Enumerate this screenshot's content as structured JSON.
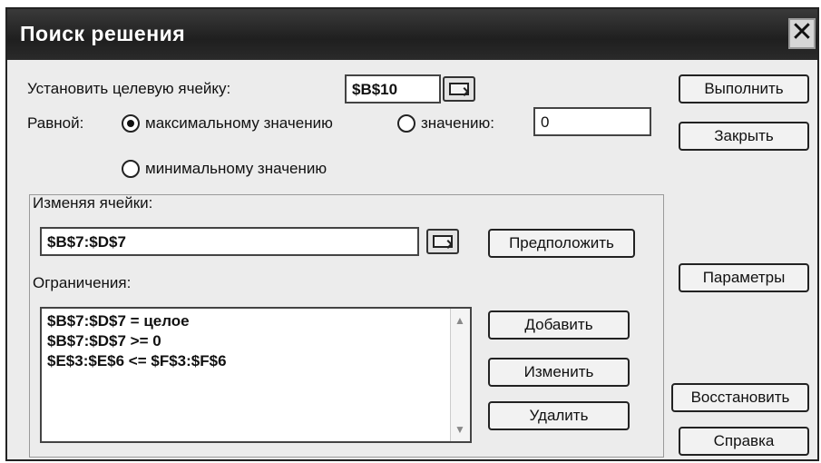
{
  "dialog": {
    "title": "Поиск решения",
    "close_glyph": "✕"
  },
  "target": {
    "label": "Установить целевую ячейку:",
    "value": "$B$10"
  },
  "equal_to": {
    "label": "Равной:",
    "max_label": "максимальному значению",
    "value_label": "значению:",
    "value_input": "0",
    "min_label": "минимальному значению",
    "selected": "max"
  },
  "changing": {
    "label": "Изменяя ячейки:",
    "value": "$B$7:$D$7",
    "guess_button": "Предположить"
  },
  "constraints": {
    "label": "Ограничения:",
    "items": [
      "$B$7:$D$7 = целое",
      "$B$7:$D$7 >= 0",
      "$E$3:$E$6 <= $F$3:$F$6"
    ],
    "add_button": "Добавить",
    "change_button": "Изменить",
    "delete_button": "Удалить"
  },
  "side_buttons": {
    "solve": "Выполнить",
    "close": "Закрыть",
    "options": "Параметры",
    "reset": "Восстановить",
    "help": "Справка"
  },
  "icons": {
    "ref_button": "collapse-dialog-icon",
    "close": "close-icon",
    "scroll_up": "scroll-up-icon",
    "scroll_down": "scroll-down-icon"
  }
}
